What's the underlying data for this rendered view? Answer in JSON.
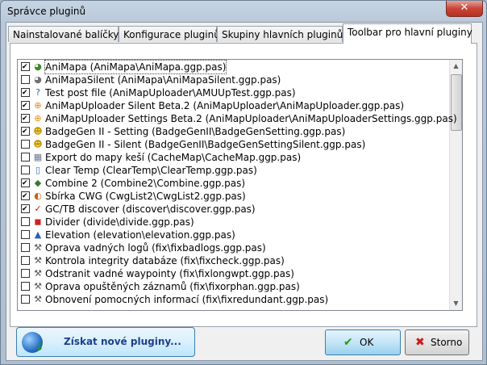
{
  "window": {
    "title": "Správce pluginů",
    "close_label": "✕"
  },
  "tabs": [
    {
      "label": "Nainstalované balíčky",
      "active": false
    },
    {
      "label": "Konfigurace pluginů",
      "active": false
    },
    {
      "label": "Skupiny hlavních pluginů",
      "active": false
    },
    {
      "label": "Toolbar pro hlavní pluginy",
      "active": true
    }
  ],
  "plugins": [
    {
      "checked": true,
      "icon": "globe-icon",
      "glyph": "◕",
      "color": "#3a8c2a",
      "label": "AniMapa (AniMapa\\AniMapa.ggp.pas)"
    },
    {
      "checked": false,
      "icon": "globe-grey-icon",
      "glyph": "◕",
      "color": "#707070",
      "label": "AniMapaSilent (AniMapa\\AniMapaSilent.ggp.pas)"
    },
    {
      "checked": true,
      "icon": "help-icon",
      "glyph": "?",
      "color": "#2a5fb8",
      "label": "Test post file (AniMapUploader\\AMUUpTest.ggp.pas)"
    },
    {
      "checked": true,
      "icon": "upload-icon",
      "glyph": "⊕",
      "color": "#e08a10",
      "label": "AniMapUploader Silent Beta.2 (AniMapUploader\\AniMapUploader.ggp.pas)"
    },
    {
      "checked": true,
      "icon": "upload-icon",
      "glyph": "⊕",
      "color": "#e08a10",
      "label": "AniMapUploader Settings Beta.2 (AniMapUploader\\AniMapUploaderSettings.ggp.pas)"
    },
    {
      "checked": true,
      "icon": "badge-icon",
      "glyph": "☻",
      "color": "#c89a00",
      "label": "BadgeGen II - Setting (BadgeGenII\\BadgeGenSetting.ggp.pas)"
    },
    {
      "checked": false,
      "icon": "badge-icon",
      "glyph": "☻",
      "color": "#c89a00",
      "label": "BadgeGen II - Silent (BadgeGenII\\BadgeGenSettingSilent.ggp.pas)"
    },
    {
      "checked": false,
      "icon": "map-icon",
      "glyph": "▦",
      "color": "#6a7a90",
      "label": "Export do mapy keší (CacheMap\\CacheMap.ggp.pas)"
    },
    {
      "checked": false,
      "icon": "clear-icon",
      "glyph": "▯",
      "color": "#3a6fb0",
      "label": "Clear Temp (ClearTemp\\ClearTemp.ggp.pas)"
    },
    {
      "checked": true,
      "icon": "combine-icon",
      "glyph": "◆",
      "color": "#3a7a2a",
      "label": "Combine 2 (Combine2\\Combine.ggp.pas)"
    },
    {
      "checked": true,
      "icon": "collection-icon",
      "glyph": "◐",
      "color": "#d06010",
      "label": "Sbírka CWG (CwgList2\\CwgList2.ggp.pas)"
    },
    {
      "checked": true,
      "icon": "discover-icon",
      "glyph": "✓",
      "color": "#c02020",
      "label": "GC/TB discover (discover\\discover.ggp.pas)"
    },
    {
      "checked": false,
      "icon": "divider-icon",
      "glyph": "◼",
      "color": "#d02020",
      "label": "Divider (divide\\divide.ggp.pas)"
    },
    {
      "checked": false,
      "icon": "elevation-icon",
      "glyph": "▲",
      "color": "#2a5fb8",
      "label": "Elevation (elevation\\elevation.ggp.pas)"
    },
    {
      "checked": false,
      "icon": "wrench-icon",
      "glyph": "⚒",
      "color": "#555555",
      "label": "Oprava vadných logů (fix\\fixbadlogs.ggp.pas)"
    },
    {
      "checked": false,
      "icon": "wrench-icon",
      "glyph": "⚒",
      "color": "#555555",
      "label": "Kontrola integrity databáze (fix\\fixcheck.ggp.pas)"
    },
    {
      "checked": false,
      "icon": "wrench-icon",
      "glyph": "⚒",
      "color": "#555555",
      "label": "Odstranit vadné waypointy (fix\\fixlongwpt.ggp.pas)"
    },
    {
      "checked": false,
      "icon": "wrench-icon",
      "glyph": "⚒",
      "color": "#555555",
      "label": "Oprava opuštěných záznamů (fix\\fixorphan.ggp.pas)"
    },
    {
      "checked": false,
      "icon": "wrench-icon",
      "glyph": "⚒",
      "color": "#555555",
      "label": "Obnovení pomocných informací (fix\\fixredundant.ggp.pas)"
    }
  ],
  "buttons": {
    "get_plugins": "Získat nové pluginy...",
    "ok": "OK",
    "cancel": "Storno"
  }
}
